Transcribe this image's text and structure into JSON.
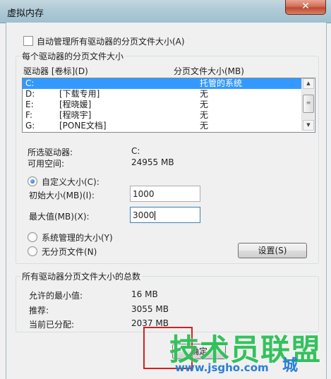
{
  "window": {
    "title": "虚拟内存",
    "close_glyph": "✕"
  },
  "auto_manage": {
    "label": "自动管理所有驱动器的分页文件大小(A)",
    "checked": false
  },
  "per_drive_group": {
    "legend": "每个驱动器的分页文件大小",
    "col_drive": "驱动器 [卷标](D)",
    "col_size": "分页文件大小(MB)",
    "drives": [
      {
        "letter": "C:",
        "label": "",
        "size": "托管的系统",
        "selected": true
      },
      {
        "letter": "D:",
        "label": "[下载专用]",
        "size": "无",
        "selected": false
      },
      {
        "letter": "E:",
        "label": "[程晓媛]",
        "size": "无",
        "selected": false
      },
      {
        "letter": "F:",
        "label": "[程晓宇]",
        "size": "无",
        "selected": false
      },
      {
        "letter": "G:",
        "label": "[PONE文档]",
        "size": "无",
        "selected": false
      }
    ],
    "selected_drive_label": "所选驱动器:",
    "selected_drive_value": "C:",
    "free_space_label": "可用空间:",
    "free_space_value": "24955 MB",
    "custom_size": {
      "label": "自定义大小(C):",
      "selected": true
    },
    "initial_size": {
      "label": "初始大小(MB)(I):",
      "value": "1000"
    },
    "max_size": {
      "label": "最大值(MB)(X):",
      "value": "3000"
    },
    "system_managed": {
      "label": "系统管理的大小(Y)",
      "selected": false
    },
    "no_paging": {
      "label": "无分页文件(N)",
      "selected": false
    },
    "set_button": "设置(S)"
  },
  "total_group": {
    "legend": "所有驱动器分页文件大小的总数",
    "min_label": "允许的最小值:",
    "min_value": "16 MB",
    "recommended_label": "推荐:",
    "recommended_value": "3055 MB",
    "allocated_label": "当前已分配:",
    "allocated_value": "2037 MB"
  },
  "ok_button": "确定",
  "watermark": {
    "main": "技术员联盟",
    "url": "www.jsgho.com",
    "tail": "城"
  }
}
